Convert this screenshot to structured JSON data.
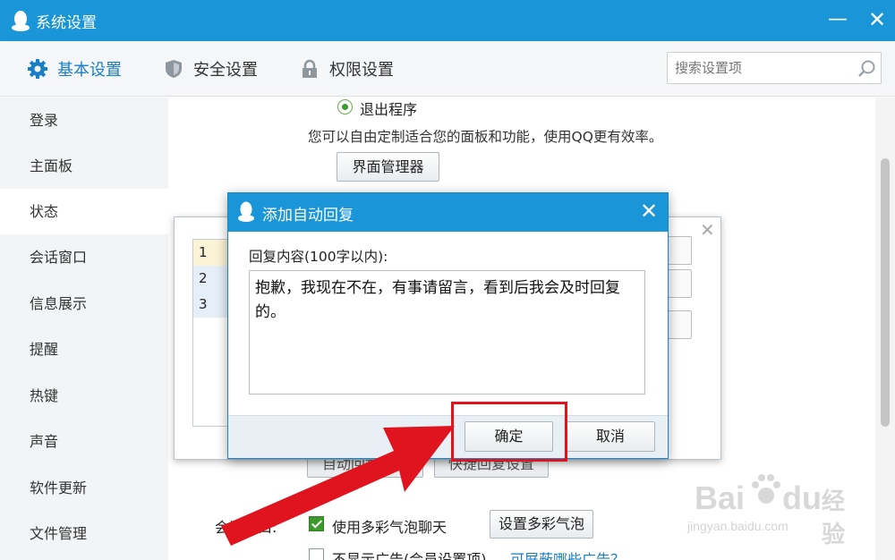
{
  "window": {
    "title": "系统设置",
    "minimize": "—",
    "close": "✕"
  },
  "tabs": [
    {
      "label": "基本设置",
      "icon": "gear-icon",
      "active": true
    },
    {
      "label": "安全设置",
      "icon": "shield-icon",
      "active": false
    },
    {
      "label": "权限设置",
      "icon": "lock-icon",
      "active": false
    }
  ],
  "search": {
    "placeholder": "搜索设置项"
  },
  "sidebar": {
    "items": [
      {
        "label": "登录"
      },
      {
        "label": "主面板"
      },
      {
        "label": "状态",
        "active": true
      },
      {
        "label": "会话窗口"
      },
      {
        "label": "信息展示"
      },
      {
        "label": "提醒"
      },
      {
        "label": "热键"
      },
      {
        "label": "声音"
      },
      {
        "label": "软件更新"
      },
      {
        "label": "文件管理"
      }
    ]
  },
  "main": {
    "radio_exit": "退出程序",
    "description": "您可以自由定制适合您的面板和功能，使用QQ更有效率。",
    "ui_manager_button": "界面管理器",
    "session_label": "会话窗口:",
    "colorful_bubble_checkbox": "使用多彩气泡聊天",
    "set_bubble_button": "设置多彩气泡",
    "no_ads_checkbox": "不显示广告(会员设置项)",
    "ads_link": "可屏蔽哪些广告？",
    "hidden_button_1": "自动回复设置",
    "hidden_button_2": "快捷回复设置"
  },
  "back_dialog": {
    "close": "✕",
    "rows": [
      "1",
      "2",
      "3"
    ]
  },
  "dialog": {
    "title": "添加自动回复",
    "close": "✕",
    "label": "回复内容(100字以内):",
    "content": "抱歉，我现在不在，有事请留言，看到后我会及时回复的。",
    "ok_button": "确定",
    "cancel_button": "取消"
  },
  "colors": {
    "brand": "#1a96d8",
    "highlight": "#e0141e",
    "accent": "#1a7ec7"
  },
  "watermark": {
    "brand": "Bai",
    "brand2": "du",
    "cn": "经验",
    "url": "jingyan.baidu.com"
  }
}
